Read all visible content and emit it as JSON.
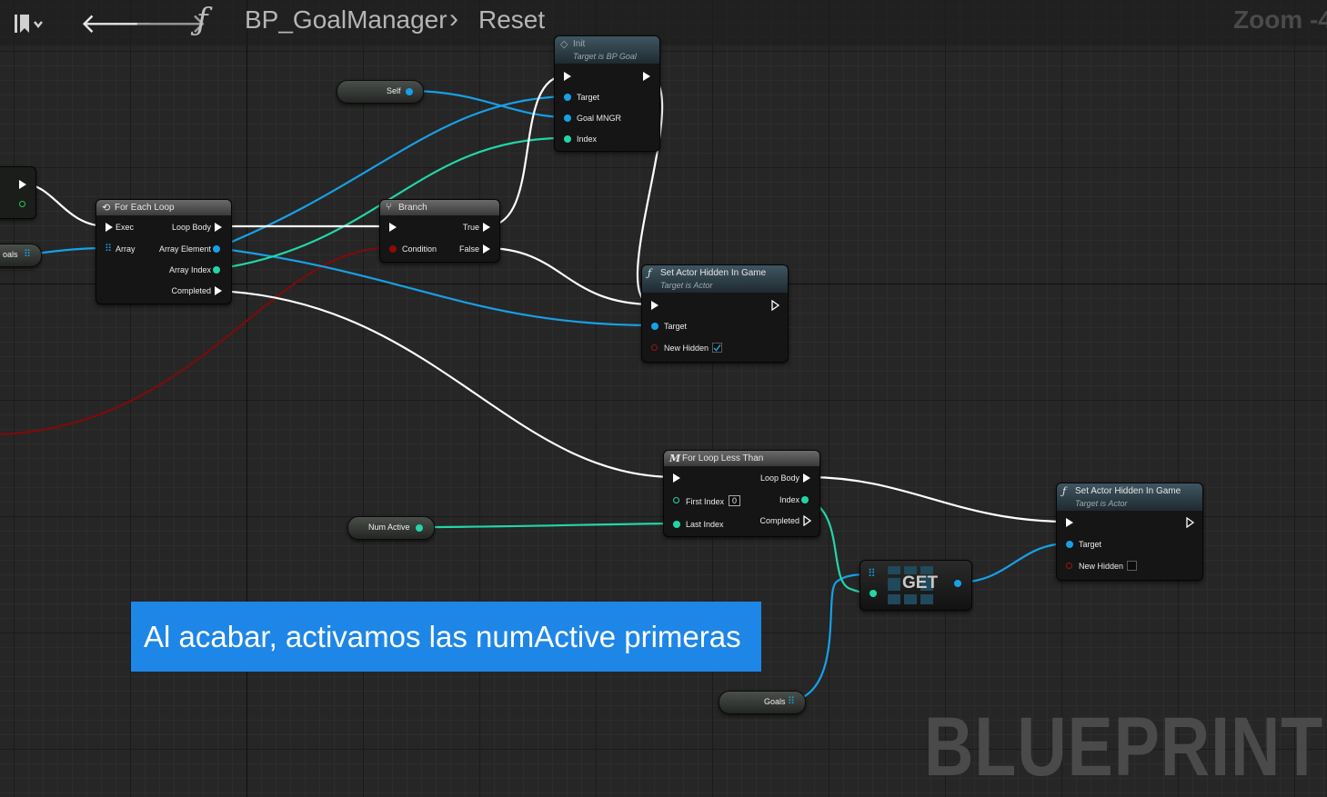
{
  "toolbar": {
    "back_icon": "arrow-left-icon",
    "forward_icon": "arrow-right-icon",
    "function_symbol": "ƒ",
    "breadcrumb": [
      "BP_GoalManager",
      "Reset"
    ],
    "breadcrumb_separator": "›",
    "zoom_label": "Zoom -4"
  },
  "nodes": {
    "init": {
      "title": "Init",
      "subtitle": "Target is BP Goal",
      "pins": [
        "Target",
        "Goal MNGR",
        "Index"
      ]
    },
    "for_each": {
      "title": "For Each Loop",
      "inputs": [
        "Exec",
        "Array"
      ],
      "outputs": [
        "Loop Body",
        "Array Element",
        "Array Index",
        "Completed"
      ]
    },
    "branch": {
      "title": "Branch",
      "inputs": [
        "Condition"
      ],
      "outputs": [
        "True",
        "False"
      ]
    },
    "set_hidden_1": {
      "title": "Set Actor Hidden In Game",
      "subtitle": "Target is Actor",
      "pins": [
        "Target",
        "New Hidden"
      ],
      "new_hidden_checked": true
    },
    "for_loop": {
      "title": "For Loop Less Than",
      "inputs": [
        "First Index",
        "Last Index"
      ],
      "outputs": [
        "Loop Body",
        "Index",
        "Completed"
      ],
      "first_index_value": "0"
    },
    "set_hidden_2": {
      "title": "Set Actor Hidden In Game",
      "subtitle": "Target is Actor",
      "pins": [
        "Target",
        "New Hidden"
      ],
      "new_hidden_checked": false
    },
    "get": {
      "title": "GET"
    }
  },
  "variables": {
    "self": "Self",
    "num_active": "Num Active",
    "goals": "Goals",
    "goals_partial": "oals"
  },
  "caption": "Al acabar, activamos las numActive primeras",
  "watermark": "BLUEPRINT",
  "colors": {
    "exec_wire": "#ffffff",
    "object_wire": "#17a0e6",
    "int_wire": "#23d5a8",
    "bool_wire": "#8e0a0a",
    "caption_bg": "#1e86e6"
  }
}
